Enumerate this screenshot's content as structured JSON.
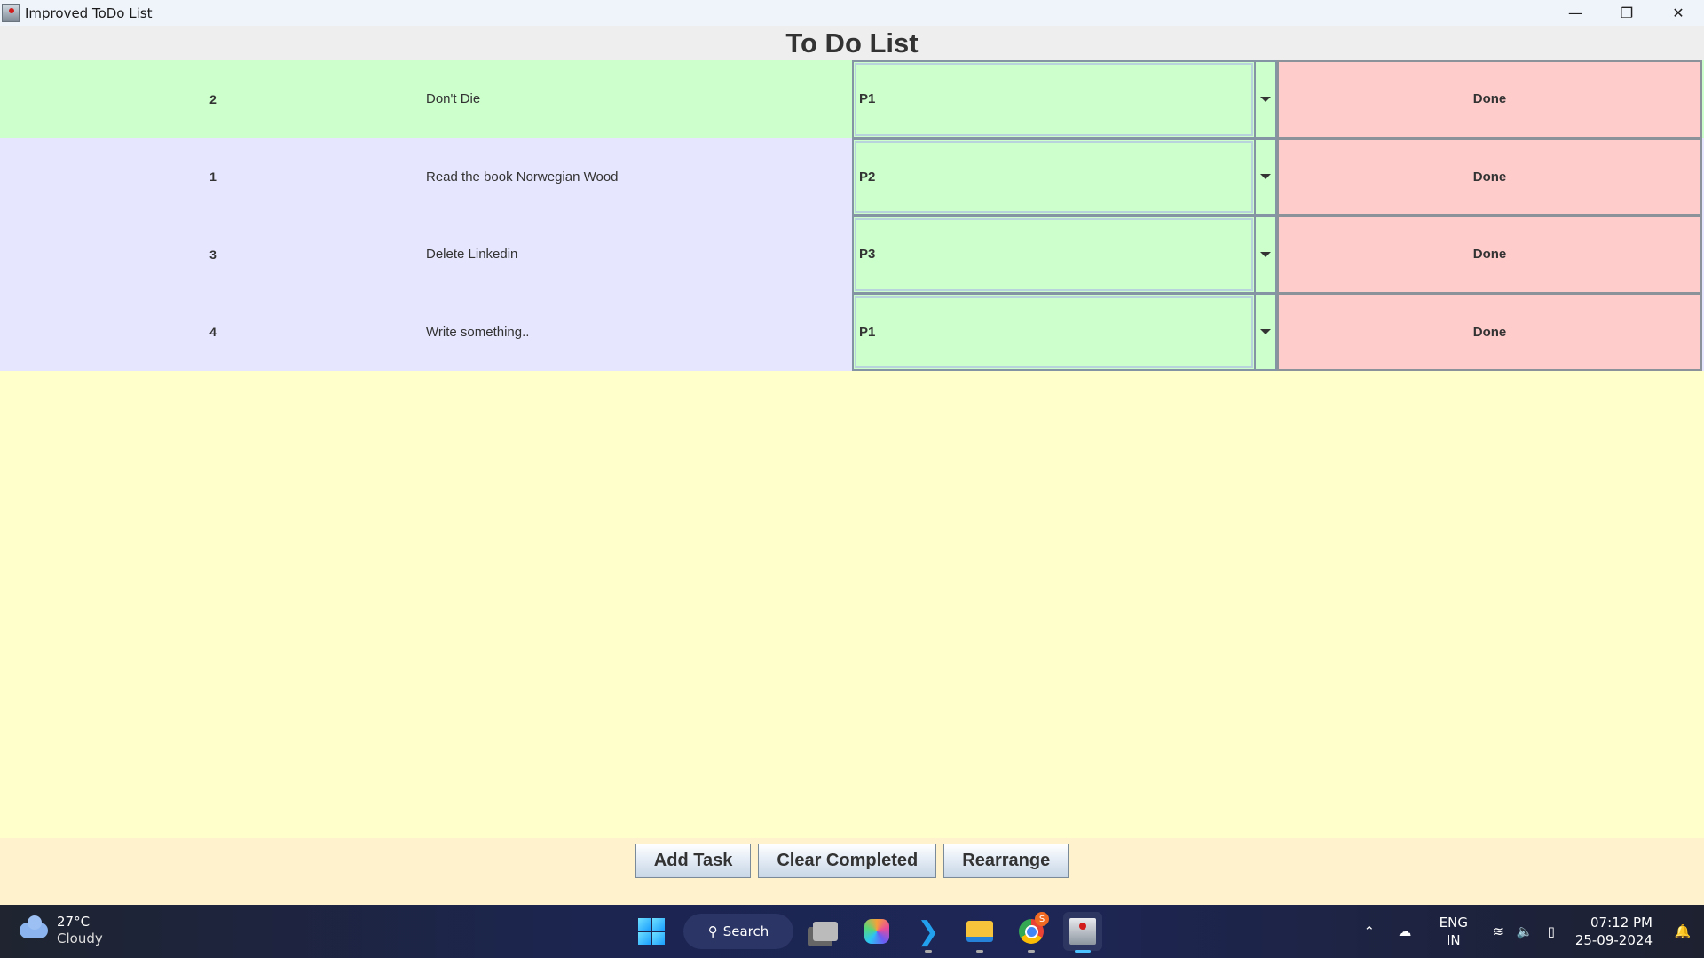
{
  "window": {
    "title": "Improved ToDo List",
    "controls": {
      "minimize": "—",
      "restore": "❐",
      "close": "✕"
    }
  },
  "header": {
    "title": "To Do List"
  },
  "colors": {
    "row_highlight": "#ccffcc",
    "row_normal": "#e6e6ff",
    "combo_bg": "#ccffcc",
    "done_bg": "#ffcccc",
    "empty_area": "#ffffcc",
    "button_bar": "#fff2cc"
  },
  "tasks": [
    {
      "number": "2",
      "text": "Don't Die",
      "priority": "P1",
      "done_label": "Done",
      "highlight": true
    },
    {
      "number": "1",
      "text": "Read the book Norwegian Wood",
      "priority": "P2",
      "done_label": "Done",
      "highlight": false
    },
    {
      "number": "3",
      "text": "Delete Linkedin",
      "priority": "P3",
      "done_label": "Done",
      "highlight": false
    },
    {
      "number": "4",
      "text": "Write something..",
      "priority": "P1",
      "done_label": "Done",
      "highlight": false
    }
  ],
  "buttons": {
    "add_task": "Add Task",
    "clear_completed": "Clear Completed",
    "rearrange": "Rearrange"
  },
  "taskbar": {
    "weather": {
      "temp": "27°C",
      "condition": "Cloudy",
      "icon": "cloud-icon"
    },
    "search_label": "Search",
    "chrome_badge": "S",
    "apps": [
      "start-icon",
      "search-icon",
      "task-view-icon",
      "copilot-icon",
      "vscode-icon",
      "file-explorer-icon",
      "chrome-icon",
      "java-app-icon"
    ],
    "tray": {
      "lang_line1": "ENG",
      "lang_line2": "IN",
      "time": "07:12 PM",
      "date": "25-09-2024"
    }
  }
}
